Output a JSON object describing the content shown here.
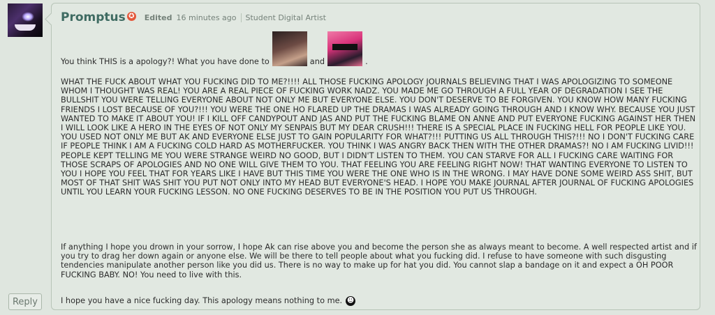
{
  "comment": {
    "username": "Promptus",
    "badge_icon": "orange-star-badge-icon",
    "badge_glyph": "✪",
    "edited_label": "Edited",
    "time": "16 minutes ago",
    "role": "Student Digital Artist",
    "line1_prefix": "You think THIS is a apology?! What you have done to",
    "line1_and": "and",
    "line1_end": ".",
    "para_caps": "WHAT THE FUCK ABOUT WHAT YOU FUCKING DID TO ME?!!!! ALL THOSE FUCKING APOLOGY JOURNALS BELIEVING THAT I WAS APOLOGIZING TO SOMEONE WHOM I THOUGHT WAS REAL! YOU ARE A REAL PIECE OF FUCKING WORK NADZ. YOU MADE ME GO THROUGH A FULL YEAR OF DEGRADATION I SEE THE BULLSHIT YOU WERE TELLING EVERYONE ABOUT NOT ONLY ME BUT EVERYONE ELSE. YOU DON'T DESERVE TO BE FORGIVEN. YOU KNOW HOW MANY FUCKING FRIENDS I LOST BECAUSE OF YOU?!!! YOU WERE THE ONE HO FLARED UP THE DRAMAS I WAS ALREADY GOING THROUGH AND I KNOW WHY. BECAUSE YOU JUST WANTED TO MAKE IT ABOUT YOU! IF I KILL OFF CANDYPOUT AND JAS AND PUT THE FUCKING BLAME ON ANNE AND PUT EVERYONE FUCKING AGAINST HER THEN I WILL LOOK LIKE A HERO IN THE EYES OF NOT ONLY MY SENPAIS BUT MY DEAR CRUSH!!! THERE IS A SPECIAL PLACE IN FUCKING HELL FOR PEOPLE LIKE YOU. YOU USED NOT ONLY ME BUT AK AND EVERYONE ELSE JUST TO GAIN POPULARITY FOR WHAT?!!! PUTTING US ALL THROUGH THIS?!!! NO I DON'T FUCKING CARE IF PEOPLE THINK I AM A FUCKING COLD HARD AS MOTHERFUCKER. YOU THINK I WAS ANGRY BACK THEN WITH THE OTHER DRAMAS?! NO I AM FUCKING LIVID!!! PEOPLE KEPT TELLING ME YOU WERE STRANGE WEIRD NO GOOD, BUT I DIDN'T LISTEN TO THEM. YOU CAN STARVE FOR ALL I FUCKING CARE WAITING FOR THOSE SCRAPS OF APOLOGIES AND NO ONE WILL GIVE THEM TO YOU. THAT FEELING YOU ARE FEELING RIGHT NOW! THAT WANTING EVERYONE TO LISTEN TO YOU I HOPE YOU FEEL THAT FOR YEARS LIKE I HAVE BUT THIS TIME YOU WERE THE ONE WHO IS IN THE WRONG. I MAY HAVE DONE SOME WEIRD ASS SHIT, BUT MOST OF THAT SHIT WAS SHIT YOU PUT NOT ONLY INTO MY HEAD BUT EVERYONE'S HEAD. I HOPE YOU MAKE JOURNAL AFTER JOURNAL OF FUCKING APOLOGIES UNTIL YOU LEARN YOUR FUCKING LESSON. NO ONE FUCKING DESERVES TO BE IN THE POSITION YOU PUT US THROUGH.",
    "para_2": "If anything I hope you drown in your sorrow, I hope Ak can rise above you and become the person she as always meant to become. A well respected artist and if you try to drag her down again or anyone else. We will be there to tell people about what you fucking did. I refuse to have someone with such disgusting tendencies manipulate another person like you did us. There is no way to make up for hat you did. You cannot slap a bandage on it and expect a OH POOR FUCKING BABY. NO! You need to live with this.",
    "para_3": "I hope you have a nice fucking day. This apology means nothing to me.",
    "smiley_glyph": "☻"
  },
  "reply_label": "Reply",
  "colors": {
    "background": "#dfe6df",
    "username": "#3f6b62",
    "badge": "#e4573a",
    "text": "#2c2c2c"
  }
}
